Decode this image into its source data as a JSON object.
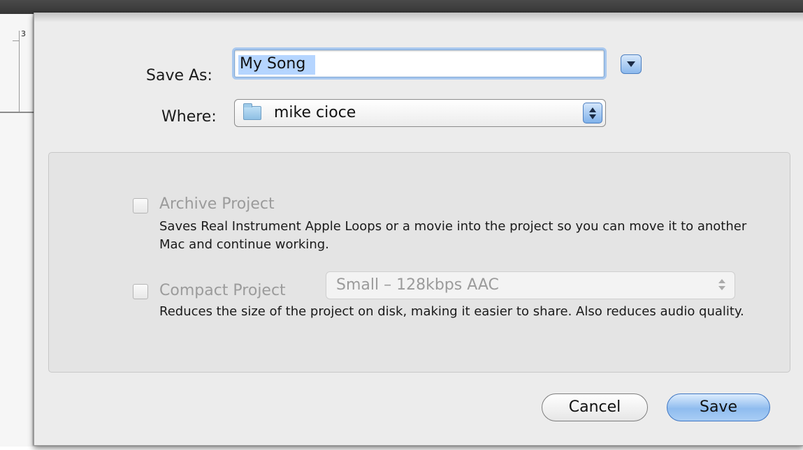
{
  "background": {
    "ruler_number": "3"
  },
  "dialog": {
    "save_as_label": "Save As:",
    "name_value": "My Song",
    "where_label": "Where:",
    "where_value": "mike cioce",
    "archive": {
      "label": "Archive Project",
      "checked": false,
      "description": "Saves Real Instrument Apple Loops or a movie into the project so you can move it to another Mac and continue working."
    },
    "compact": {
      "label": "Compact Project",
      "checked": false,
      "popup_value": "Small – 128kbps AAC",
      "description": "Reduces the size of the project on disk, making it easier to share. Also reduces audio quality."
    },
    "cancel_label": "Cancel",
    "save_label": "Save"
  },
  "colors": {
    "accent_blue": "#8fbcef",
    "focus_ring": "#a9c8ee",
    "selection": "#b5d5ff",
    "disabled_text": "#9b9b9b"
  }
}
